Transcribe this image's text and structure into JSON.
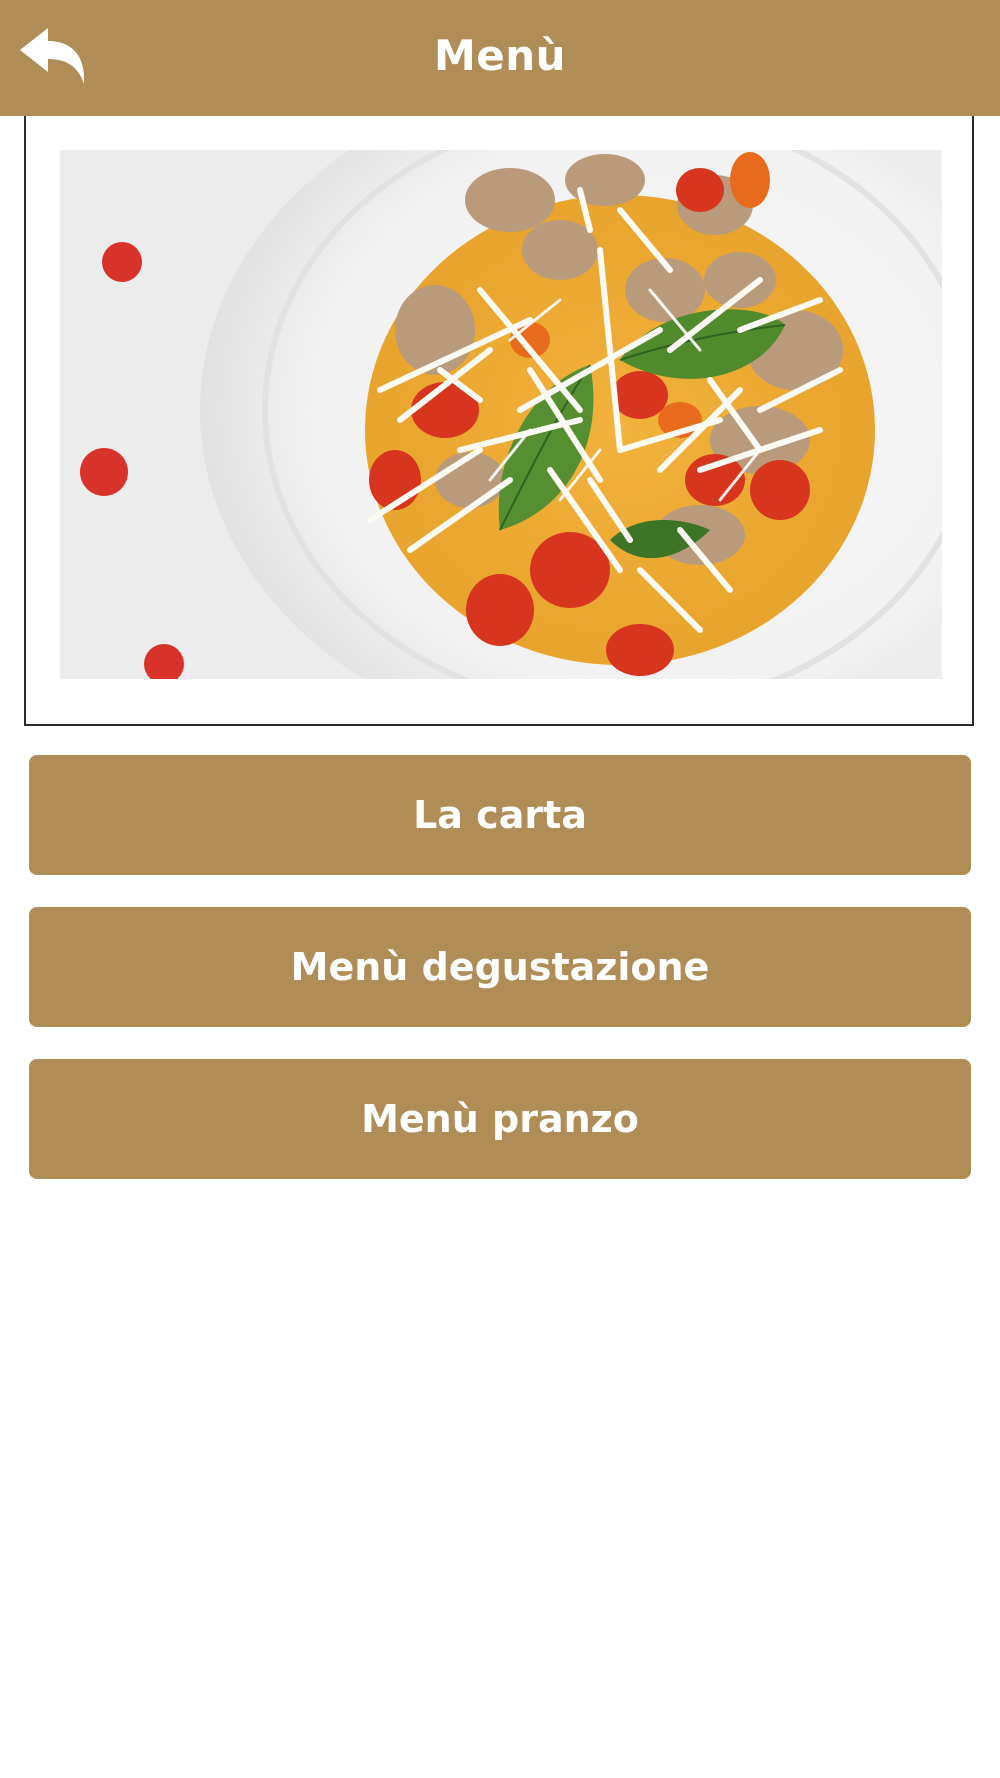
{
  "header": {
    "title": "Menù",
    "back_icon": "back-arrow-icon",
    "background_color": "#b08d57"
  },
  "hero": {
    "image_subject": "plate of gnocchi with cherry tomatoes, basil and grated cheese"
  },
  "menu_buttons": [
    {
      "label": "La carta"
    },
    {
      "label": "Menù degustazione"
    },
    {
      "label": "Menù pranzo"
    }
  ],
  "colors": {
    "accent": "#b08d57",
    "text_on_accent": "#ffffff",
    "frame_border": "#2b2b2b"
  }
}
